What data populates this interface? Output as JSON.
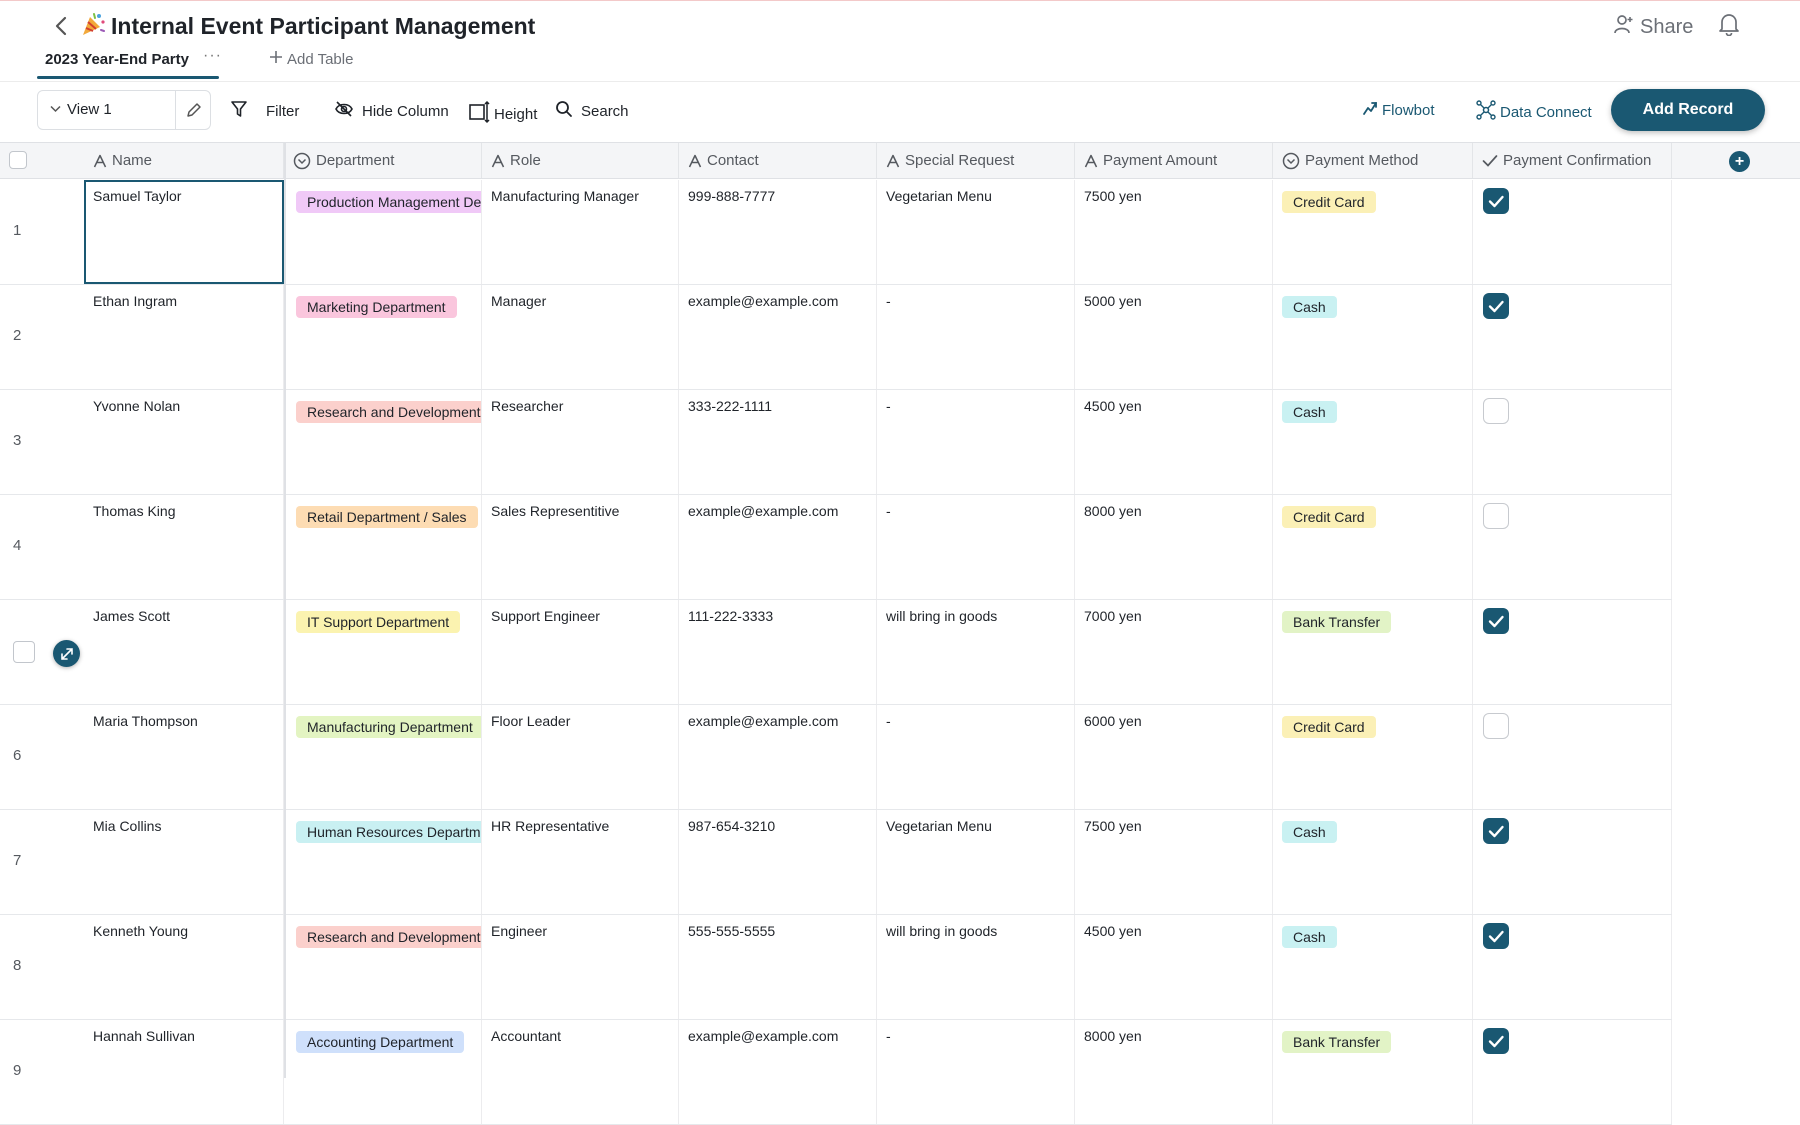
{
  "header": {
    "title": "Internal Event Participant Management",
    "share_label": "Share",
    "active_tab": "2023 Year-End Party",
    "tab_more": "···",
    "add_table_label": "Add Table"
  },
  "toolbar": {
    "view_label": "View 1",
    "filter_label": "Filter",
    "hide_column_label": "Hide Column",
    "height_label": "Height",
    "search_label": "Search",
    "flowbot_label": "Flowbot",
    "data_connect_label": "Data Connect",
    "add_record_label": "Add Record"
  },
  "columns": [
    {
      "label": "Name",
      "icon": "text-icon"
    },
    {
      "label": "Department",
      "icon": "single-select-icon"
    },
    {
      "label": "Role",
      "icon": "text-icon"
    },
    {
      "label": "Contact",
      "icon": "text-icon"
    },
    {
      "label": "Special Request",
      "icon": "text-icon"
    },
    {
      "label": "Payment Amount",
      "icon": "text-icon"
    },
    {
      "label": "Payment Method",
      "icon": "single-select-icon"
    },
    {
      "label": "Payment Confirmation",
      "icon": "checkbox-icon"
    }
  ],
  "rows": [
    {
      "num": "1",
      "name": "Samuel Taylor",
      "department": "Production Management Department",
      "role": "Manufacturing Manager",
      "contact": "999-888-7777",
      "special_request": "Vegetarian Menu",
      "payment_amount": "7500 yen",
      "payment_method": "Credit Card",
      "confirmed": true
    },
    {
      "num": "2",
      "name": "Ethan Ingram",
      "department": "Marketing Department",
      "role": "Manager",
      "contact": "example@example.com",
      "special_request": "-",
      "payment_amount": "5000 yen",
      "payment_method": "Cash",
      "confirmed": true
    },
    {
      "num": "3",
      "name": "Yvonne Nolan",
      "department": "Research and Development",
      "role": "Researcher",
      "contact": "333-222-1111",
      "special_request": "-",
      "payment_amount": "4500 yen",
      "payment_method": "Cash",
      "confirmed": false
    },
    {
      "num": "4",
      "name": "Thomas King",
      "department": "Retail Department / Sales",
      "role": "Sales Representitive",
      "contact": "example@example.com",
      "special_request": "-",
      "payment_amount": "8000 yen",
      "payment_method": "Credit Card",
      "confirmed": false
    },
    {
      "num": "5",
      "name": "James Scott",
      "department": "IT Support Department",
      "role": "Support Engineer",
      "contact": "111-222-3333",
      "special_request": "will bring in goods",
      "payment_amount": "7000 yen",
      "payment_method": "Bank Transfer",
      "confirmed": true
    },
    {
      "num": "6",
      "name": "Maria Thompson",
      "department": "Manufacturing Department",
      "role": "Floor Leader",
      "contact": "example@example.com",
      "special_request": "-",
      "payment_amount": "6000 yen",
      "payment_method": "Credit Card",
      "confirmed": false
    },
    {
      "num": "7",
      "name": "Mia Collins",
      "department": "Human Resources Department",
      "role": "HR Representative",
      "contact": "987-654-3210",
      "special_request": "Vegetarian Menu",
      "payment_amount": "7500 yen",
      "payment_method": "Cash",
      "confirmed": true
    },
    {
      "num": "8",
      "name": "Kenneth Young",
      "department": "Research and Development",
      "role": "Engineer",
      "contact": "555-555-5555",
      "special_request": "will bring in goods",
      "payment_amount": "4500 yen",
      "payment_method": "Cash",
      "confirmed": true
    },
    {
      "num": "9",
      "name": "Hannah Sullivan",
      "department": "Accounting Department",
      "role": "Accountant",
      "contact": "example@example.com",
      "special_request": "-",
      "payment_amount": "8000 yen",
      "payment_method": "Bank Transfer",
      "confirmed": true
    }
  ],
  "department_colors": {
    "Production Management Department": "#f0c9f7",
    "Marketing Department": "#fac6dd",
    "Research and Development": "#fbd0cc",
    "Retail Department / Sales": "#fddcb3",
    "IT Support Department": "#fbf3b0",
    "Manufacturing Department": "#e3f4c2",
    "Human Resources Department": "#c9f0f2",
    "Accounting Department": "#cfe0fb"
  },
  "payment_method_colors": {
    "Credit Card": "#fbf0b6",
    "Cash": "#c9f1f2",
    "Bank Transfer": "#e2f3c6"
  },
  "colors": {
    "accent": "#1a5872",
    "header_bg": "#f4f5f7"
  }
}
